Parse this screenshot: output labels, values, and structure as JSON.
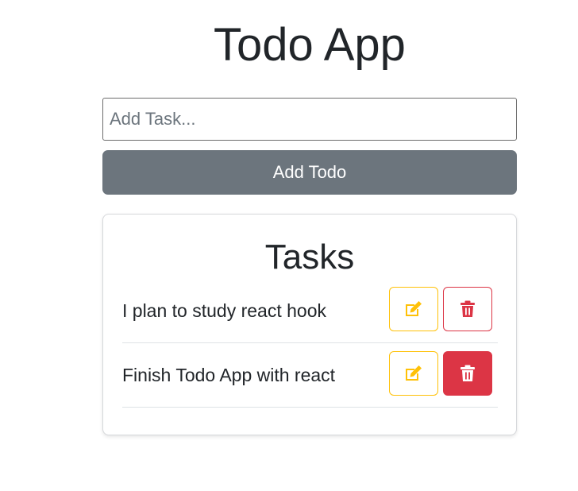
{
  "app": {
    "title": "Todo App"
  },
  "input": {
    "placeholder": "Add Task...",
    "value": ""
  },
  "add_button": {
    "label": "Add Todo"
  },
  "tasks_card": {
    "title": "Tasks",
    "items": [
      {
        "text": "I plan to study react hook",
        "edit_icon": "edit-icon",
        "delete_icon": "trash-icon",
        "delete_style": "outline"
      },
      {
        "text": "Finish Todo App with react",
        "edit_icon": "edit-icon",
        "delete_icon": "trash-icon",
        "delete_style": "filled"
      }
    ]
  },
  "colors": {
    "primary_text": "#212529",
    "secondary_button": "#6c757d",
    "warning": "#ffc107",
    "danger": "#dc3545"
  }
}
